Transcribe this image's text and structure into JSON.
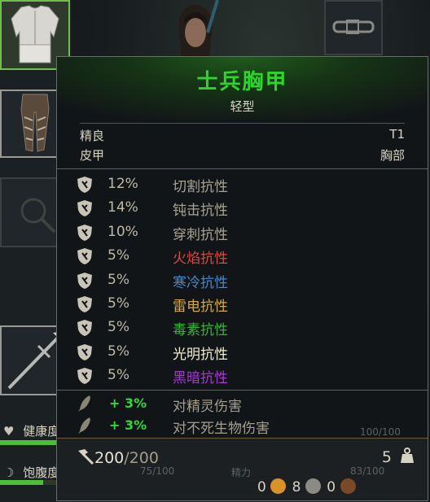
{
  "item": {
    "name": "士兵胸甲",
    "weight_class": "轻型",
    "quality": "精良",
    "tier": "T1",
    "material": "皮甲",
    "slot": "胸部"
  },
  "resistances": [
    {
      "icon": "slash-shield-icon",
      "value": "12%",
      "name": "切割抗性",
      "color": "#a8a395"
    },
    {
      "icon": "blunt-shield-icon",
      "value": "14%",
      "name": "钝击抗性",
      "color": "#a8a395"
    },
    {
      "icon": "pierce-shield-icon",
      "value": "10%",
      "name": "穿刺抗性",
      "color": "#a8a395"
    },
    {
      "icon": "fire-shield-icon",
      "value": "5%",
      "name": "火焰抗性",
      "color": "#d94a44"
    },
    {
      "icon": "frost-shield-icon",
      "value": "5%",
      "name": "寒冷抗性",
      "color": "#4a87c9"
    },
    {
      "icon": "lightning-shield-icon",
      "value": "5%",
      "name": "雷电抗性",
      "color": "#d6aa3c"
    },
    {
      "icon": "poison-shield-icon",
      "value": "5%",
      "name": "毒素抗性",
      "color": "#36b43a"
    },
    {
      "icon": "light-shield-icon",
      "value": "5%",
      "name": "光明抗性",
      "color": "#f0ecd0"
    },
    {
      "icon": "dark-shield-icon",
      "value": "5%",
      "name": "黑暗抗性",
      "color": "#a33bd0"
    }
  ],
  "bonuses": [
    {
      "icon": "feather-icon",
      "value": "+ 3%",
      "name": "对精灵伤害"
    },
    {
      "icon": "feather-icon",
      "value": "+ 3%",
      "name": "对不死生物伤害"
    }
  ],
  "durability": {
    "current": "200",
    "max": "/200"
  },
  "weight": "5",
  "currency": {
    "gold": "0",
    "silver": "8",
    "copper": "0"
  },
  "background": {
    "health_label": "健康度",
    "hunger_label": "饱腹度",
    "health_value": "100/100",
    "hunger_value": "75/100",
    "energy_label": "精力",
    "energy_value": "83/100",
    "health_fraction": 1.0,
    "hunger_fraction": 0.75
  }
}
